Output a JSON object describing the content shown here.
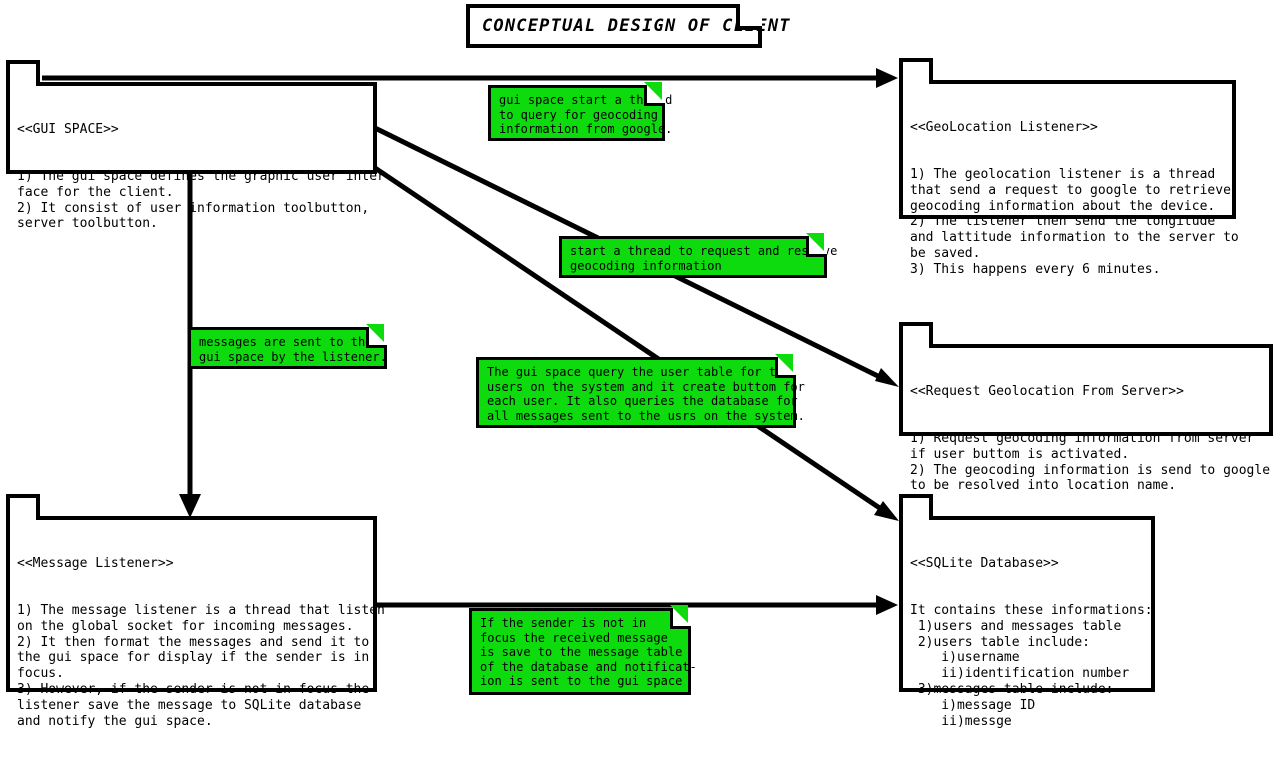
{
  "title_note": {
    "text": "CONCEPTUAL DESIGN OF CLIENT"
  },
  "colors": {
    "note_green": "#0ddb0d",
    "stroke": "#000000",
    "background": "#ffffff"
  },
  "packages": [
    {
      "id": "gui-space",
      "stereotype": "<<GUI SPACE>>",
      "body": "1) The gui space defines the graphic user inter-\nface for the client.\n2) It consist of user information toolbutton,\nserver toolbutton."
    },
    {
      "id": "geolocation-listener",
      "stereotype": "<<GeoLocation Listener>>",
      "body": "1) The geolocation listener is a thread\nthat send a request to google to retrieve\ngeocoding information about the device.\n2) The listener then send the longitude\nand lattitude information to the server to\nbe saved.\n3) This happens every 6 minutes."
    },
    {
      "id": "request-geolocation-from-server",
      "stereotype": "<<Request Geolocation From Server>>",
      "body": "1) Request geocoding information from server\nif user buttom is activated.\n2) The geocoding information is send to google\nto be resolved into location name."
    },
    {
      "id": "message-listener",
      "stereotype": "<<Message Listener>>",
      "body": "1) The message listener is a thread that listen\non the global socket for incoming messages.\n2) It then format the messages and send it to\nthe gui space for display if the sender is in\nfocus.\n3) However, if the sender is not in focus the\nlistener save the message to SQLite database\nand notify the gui space."
    },
    {
      "id": "sqlite-database",
      "stereotype": "<<SQLite Database>>",
      "body": "It contains these informations:\n 1)users and messages table\n 2)users table include:\n    i)username\n    ii)identification number\n 3)messages table include:\n    i)message ID\n    ii)messge"
    }
  ],
  "notes": [
    {
      "id": "note-gui-to-geolocation",
      "text": "gui space start a thread\nto query for geocoding\ninformation from google."
    },
    {
      "id": "note-start-thread-resolve",
      "text": "start a thread to request and resolve\ngeocoding information"
    },
    {
      "id": "note-messages-sent",
      "text": "messages are sent to the\ngui space by the listener."
    },
    {
      "id": "note-gui-query-user-table",
      "text": "The gui space query the user table for the\nusers on the system and it create buttom for\neach user. It also queries the database for\nall messages sent to the usrs on the system."
    },
    {
      "id": "note-sender-not-in-focus",
      "text": "If the sender is not in\nfocus the received message\nis save to the message table\nof the database and notificat-\nion is sent to the gui space"
    }
  ]
}
